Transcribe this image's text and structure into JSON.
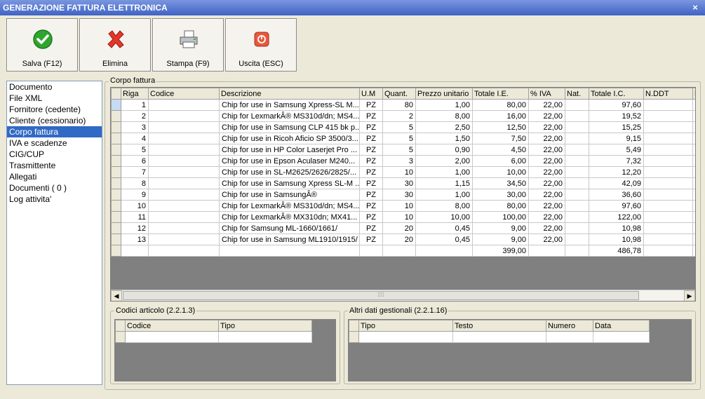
{
  "window": {
    "title": "GENERAZIONE FATTURA ELETTRONICA",
    "close_label": "×"
  },
  "toolbar": {
    "save_label": "Salva (F12)",
    "delete_label": "Elimina",
    "print_label": "Stampa (F9)",
    "exit_label": "Uscita (ESC)"
  },
  "sidebar": {
    "items": [
      {
        "label": "Documento"
      },
      {
        "label": "File XML"
      },
      {
        "label": "Fornitore (cedente)"
      },
      {
        "label": "Cliente (cessionario)"
      },
      {
        "label": "Corpo fattura"
      },
      {
        "label": "IVA e scadenze"
      },
      {
        "label": "CIG/CUP"
      },
      {
        "label": "Trasmittente"
      },
      {
        "label": "Allegati"
      },
      {
        "label": "Documenti ( 0 )"
      },
      {
        "label": "Log attivita'"
      }
    ],
    "selected_index": 4
  },
  "corpo": {
    "title": "Corpo fattura",
    "columns": [
      "Riga",
      "Codice",
      "Descrizione",
      "U.M",
      "Quant.",
      "Prezzo unitario",
      "Totale I.E.",
      "% IVA",
      "Nat.",
      "Totale I.C.",
      "N.DDT",
      "D"
    ],
    "rows": [
      [
        "1",
        "",
        "Chip for use in Samsung Xpress-SL  M...",
        "PZ",
        "80",
        "1,00",
        "80,00",
        "22,00",
        "",
        "97,60",
        ""
      ],
      [
        "2",
        "",
        "Chip for LexmarkÂ® MS310d/dn; MS4...",
        "PZ",
        "2",
        "8,00",
        "16,00",
        "22,00",
        "",
        "19,52",
        ""
      ],
      [
        "3",
        "",
        "Chip for use in Samsung CLP 415 bk p...",
        "PZ",
        "5",
        "2,50",
        "12,50",
        "22,00",
        "",
        "15,25",
        ""
      ],
      [
        "4",
        "",
        "Chip for use in Ricoh Aficio SP 3500/3...",
        "PZ",
        "5",
        "1,50",
        "7,50",
        "22,00",
        "",
        "9,15",
        ""
      ],
      [
        "5",
        "",
        "Chip for use in HP Color Laserjet  Pro ...",
        "PZ",
        "5",
        "0,90",
        "4,50",
        "22,00",
        "",
        "5,49",
        ""
      ],
      [
        "6",
        "",
        "Chip for use in Epson Aculaser  M240...",
        "PZ",
        "3",
        "2,00",
        "6,00",
        "22,00",
        "",
        "7,32",
        ""
      ],
      [
        "7",
        "",
        "Chip for use in SL-M2625/2626/2825/...",
        "PZ",
        "10",
        "1,00",
        "10,00",
        "22,00",
        "",
        "12,20",
        ""
      ],
      [
        "8",
        "",
        "Chip for use in Samsung Xpress SL-M ...",
        "PZ",
        "30",
        "1,15",
        "34,50",
        "22,00",
        "",
        "42,09",
        ""
      ],
      [
        "9",
        "",
        "Chip for use in SamsungÂ®",
        "PZ",
        "30",
        "1,00",
        "30,00",
        "22,00",
        "",
        "36,60",
        ""
      ],
      [
        "10",
        "",
        "Chip for LexmarkÂ® MS310d/dn; MS4...",
        "PZ",
        "10",
        "8,00",
        "80,00",
        "22,00",
        "",
        "97,60",
        ""
      ],
      [
        "11",
        "",
        "Chip for LexmarkÂ® MX310dn; MX41...",
        "PZ",
        "10",
        "10,00",
        "100,00",
        "22,00",
        "",
        "122,00",
        ""
      ],
      [
        "12",
        "",
        "Chip for Samsung ML-1660/1661/",
        "PZ",
        "20",
        "0,45",
        "9,00",
        "22,00",
        "",
        "10,98",
        ""
      ],
      [
        "13",
        "",
        "Chip for use in Samsung ML1910/1915/",
        "PZ",
        "20",
        "0,45",
        "9,00",
        "22,00",
        "",
        "10,98",
        ""
      ]
    ],
    "totals": {
      "totale_ie": "399,00",
      "totale_ic": "486,78"
    }
  },
  "codici": {
    "title": "Codici articolo (2.2.1.3)",
    "columns": [
      "Codice",
      "Tipo"
    ]
  },
  "altri": {
    "title": "Altri dati gestionali (2.2.1.16)",
    "columns": [
      "Tipo",
      "Testo",
      "Numero",
      "Data"
    ]
  },
  "colors": {
    "title_bar": "#3f63c6",
    "selected": "#316ac5",
    "grid_bg": "#808080",
    "window_bg": "#ece9d8"
  }
}
